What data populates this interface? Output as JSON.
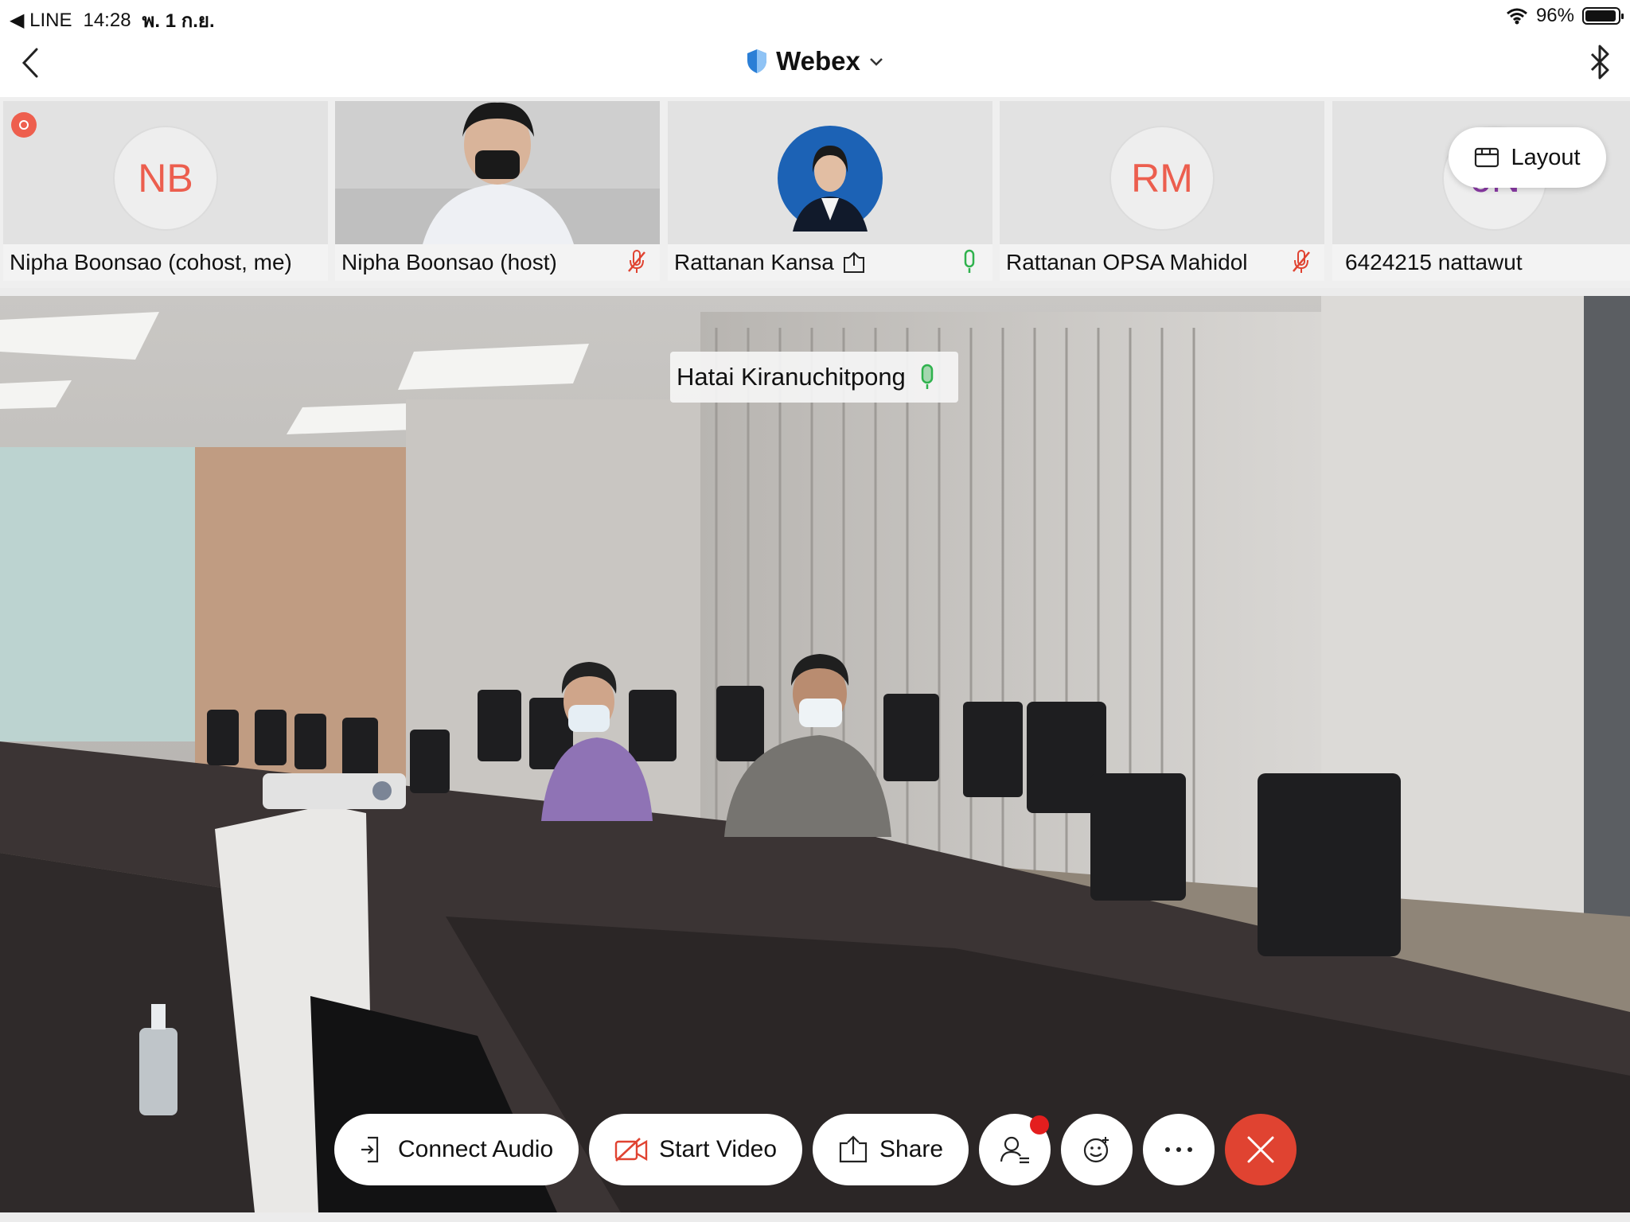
{
  "status_bar": {
    "back_app": "◀ LINE",
    "time": "14:28",
    "date": "พ. 1 ก.ย.",
    "battery": "96%"
  },
  "header": {
    "title": "Webex"
  },
  "participants": [
    {
      "name": "Nipha Boonsao (cohost, me)",
      "initials": "NB"
    },
    {
      "name": "Nipha Boonsao (host)"
    },
    {
      "name": "Rattanan Kansa"
    },
    {
      "name": "Rattanan OPSA Mahidol",
      "initials": "RM"
    },
    {
      "name": "6424215 nattawut",
      "initials": "6N"
    }
  ],
  "layout_label": "Layout",
  "active_speaker": {
    "name": "Hatai Kiranuchitpong"
  },
  "controls": {
    "connect_audio": "Connect Audio",
    "start_video": "Start Video",
    "share": "Share"
  },
  "colors": {
    "accent_red": "#e04331",
    "initials_red": "#ec5e4e",
    "mic_green": "#2fb24d"
  }
}
